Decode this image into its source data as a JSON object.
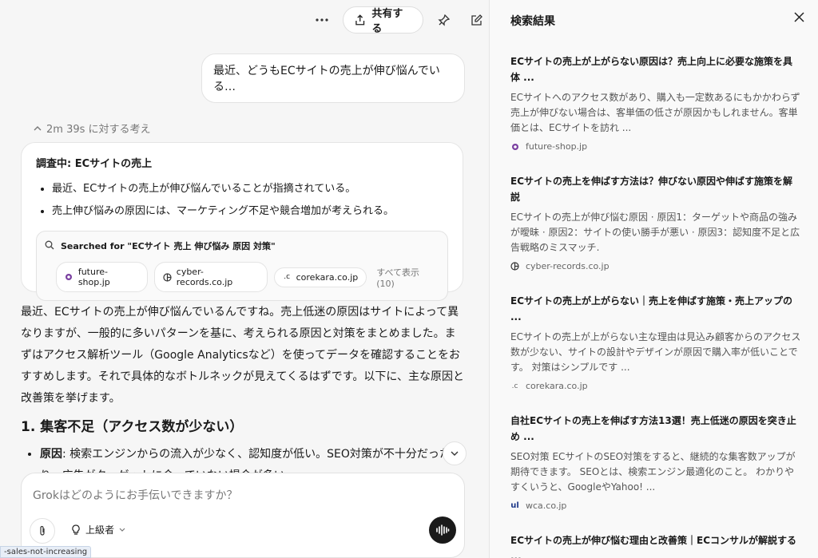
{
  "toolbar": {
    "more_icon": "more-horizontal-icon",
    "share_label": "共有する",
    "pin_icon": "pin-icon",
    "edit_icon": "edit-icon"
  },
  "user_message": "最近、どうもECサイトの売上が伸び悩んでいる…",
  "thinking": {
    "header": "2m 39s に対する考え",
    "title": "調査中: ECサイトの売上",
    "bullets": [
      "最近、ECサイトの売上が伸び悩んでいることが指摘されている。",
      "売上伸び悩みの原因には、マーケティング不足や競合増加が考えられる。"
    ],
    "search_query": "Searched for \"ECサイト 売上 伸び悩み 原因 対策\"",
    "chips": [
      "future-shop.jp",
      "cyber-records.co.jp",
      "corekara.co.jp"
    ],
    "show_all": "すべて表示 (10)"
  },
  "response": {
    "intro": "最近、ECサイトの売上が伸び悩んでいるんですね。売上低迷の原因はサイトによって異なりますが、一般的に多いパターンを基に、考えられる原因と対策をまとめました。まずはアクセス解析ツール（Google Analyticsなど）を使ってデータを確認することをおすすめします。それで具体的なボトルネックが見えてくるはずです。以下に、主な原因と改善策を挙げます。",
    "heading": "1. 集客不足（アクセス数が少ない）",
    "item_label": "原因",
    "item_text": ": 検索エンジンからの流入が少なく、認知度が低い。SEO対策が不十分だったり、広告がターゲットに合っていない場合が多い。"
  },
  "input": {
    "placeholder": "Grokはどのようにお手伝いできますか？",
    "model_label": "上級者"
  },
  "status_url": "-sales-not-increasing",
  "panel": {
    "title": "検索結果",
    "results": [
      {
        "title": "ECサイトの売上が上がらない原因は？売上向上に必要な施策を具体 ...",
        "snippet": "ECサイトへのアクセス数があり、購入も一定数あるにもかかわらず売上が伸びない場合は、客単価の低さが原因かもしれません。客単価とは、ECサイトを訪れ ...",
        "source": "future-shop.jp"
      },
      {
        "title": "ECサイトの売上を伸ばす方法は？伸びない原因や伸ばす施策を解説",
        "snippet": "ECサイトの売上が伸び悩む原因 · 原因1：ターゲットや商品の強みが曖昧 · 原因2：サイトの使い勝手が悪い · 原因3：認知度不足と広告戦略のミスマッチ.",
        "source": "cyber-records.co.jp"
      },
      {
        "title": "ECサイトの売上が上がらない｜売上を伸ばす施策・売上アップの ...",
        "snippet": "ECサイトの売上が上がらない主な理由は見込み顧客からのアクセス数が少ない、サイトの設計やデザインが原因で購入率が低いことです。 対策はシンプルです ...",
        "source": "corekara.co.jp"
      },
      {
        "title": "自社ECサイトの売上を伸ばす方法13選！売上低迷の原因を突き止め ...",
        "snippet": "SEO対策 ECサイトのSEO対策をすると、継続的な集客数アップが期待できます。 SEOとは、検索エンジン最適化のこと。 わかりやすくいうと、GoogleやYahoo! ...",
        "source": "wca.co.jp"
      },
      {
        "title": "ECサイトの売上が伸び悩む理由と改善策｜ECコンサルが解説する ...",
        "snippet": "",
        "source": ""
      }
    ]
  }
}
